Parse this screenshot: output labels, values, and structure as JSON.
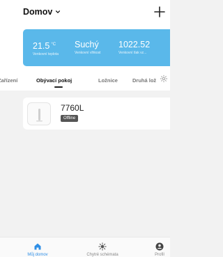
{
  "header": {
    "home_name": "Domov",
    "chevron_icon": "chevron-down-icon",
    "add_icon": "plus-icon"
  },
  "weather": {
    "accent_color": "#5ab8ea",
    "items": [
      {
        "value": "21.5",
        "unit": "°C",
        "label": "Venkovní teplota"
      },
      {
        "value": "Suchý",
        "unit": "",
        "label": "Venkovní vlhkost"
      },
      {
        "value": "1022.52",
        "unit": "",
        "label": "Venkovní tlak vz..."
      }
    ]
  },
  "tabs": {
    "items": [
      {
        "label": "Zařízení",
        "active": false
      },
      {
        "label": "Obývací pokoj",
        "active": true
      },
      {
        "label": "Ložnice",
        "active": false
      },
      {
        "label": "Druhá lož",
        "active": false
      }
    ],
    "settings_icon": "gear-icon"
  },
  "devices": [
    {
      "name": "7760L",
      "status": "Offline",
      "icon": "device-thumbnail-icon"
    }
  ],
  "bottom_nav": {
    "accent_color": "#2f8fe6",
    "items": [
      {
        "label": "Můj domov",
        "icon": "home-icon",
        "active": true
      },
      {
        "label": "Chytré schémata",
        "icon": "sun-icon",
        "active": false
      },
      {
        "label": "Profil",
        "icon": "profile-icon",
        "active": false
      }
    ]
  }
}
